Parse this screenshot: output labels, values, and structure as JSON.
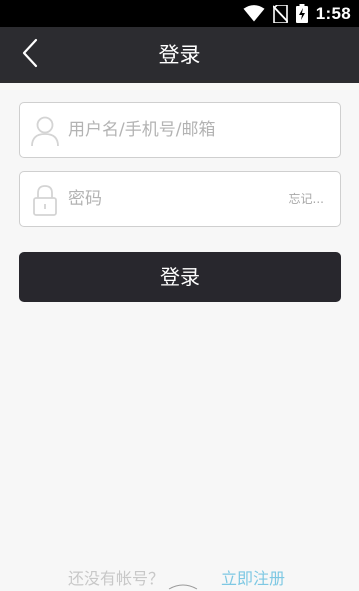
{
  "status_bar": {
    "time": "1:58",
    "icons": [
      "wifi-icon",
      "no-sim-icon",
      "battery-charging-icon"
    ]
  },
  "app_bar": {
    "back_icon": "chevron-left-icon",
    "title": "登录"
  },
  "form": {
    "username": {
      "icon": "user-icon",
      "placeholder": "用户名/手机号/邮箱"
    },
    "password": {
      "icon": "lock-icon",
      "placeholder": "密码",
      "forgot_label": "忘记..."
    },
    "login_button": "登录"
  },
  "footer": {
    "no_account": "还没有帐号？",
    "register_link": "立即注册"
  },
  "colors": {
    "status_bar": "#000000",
    "app_bar": "#2c2c30",
    "background": "#f7f7f7",
    "button": "#28272d",
    "link": "#7ec8e3"
  }
}
